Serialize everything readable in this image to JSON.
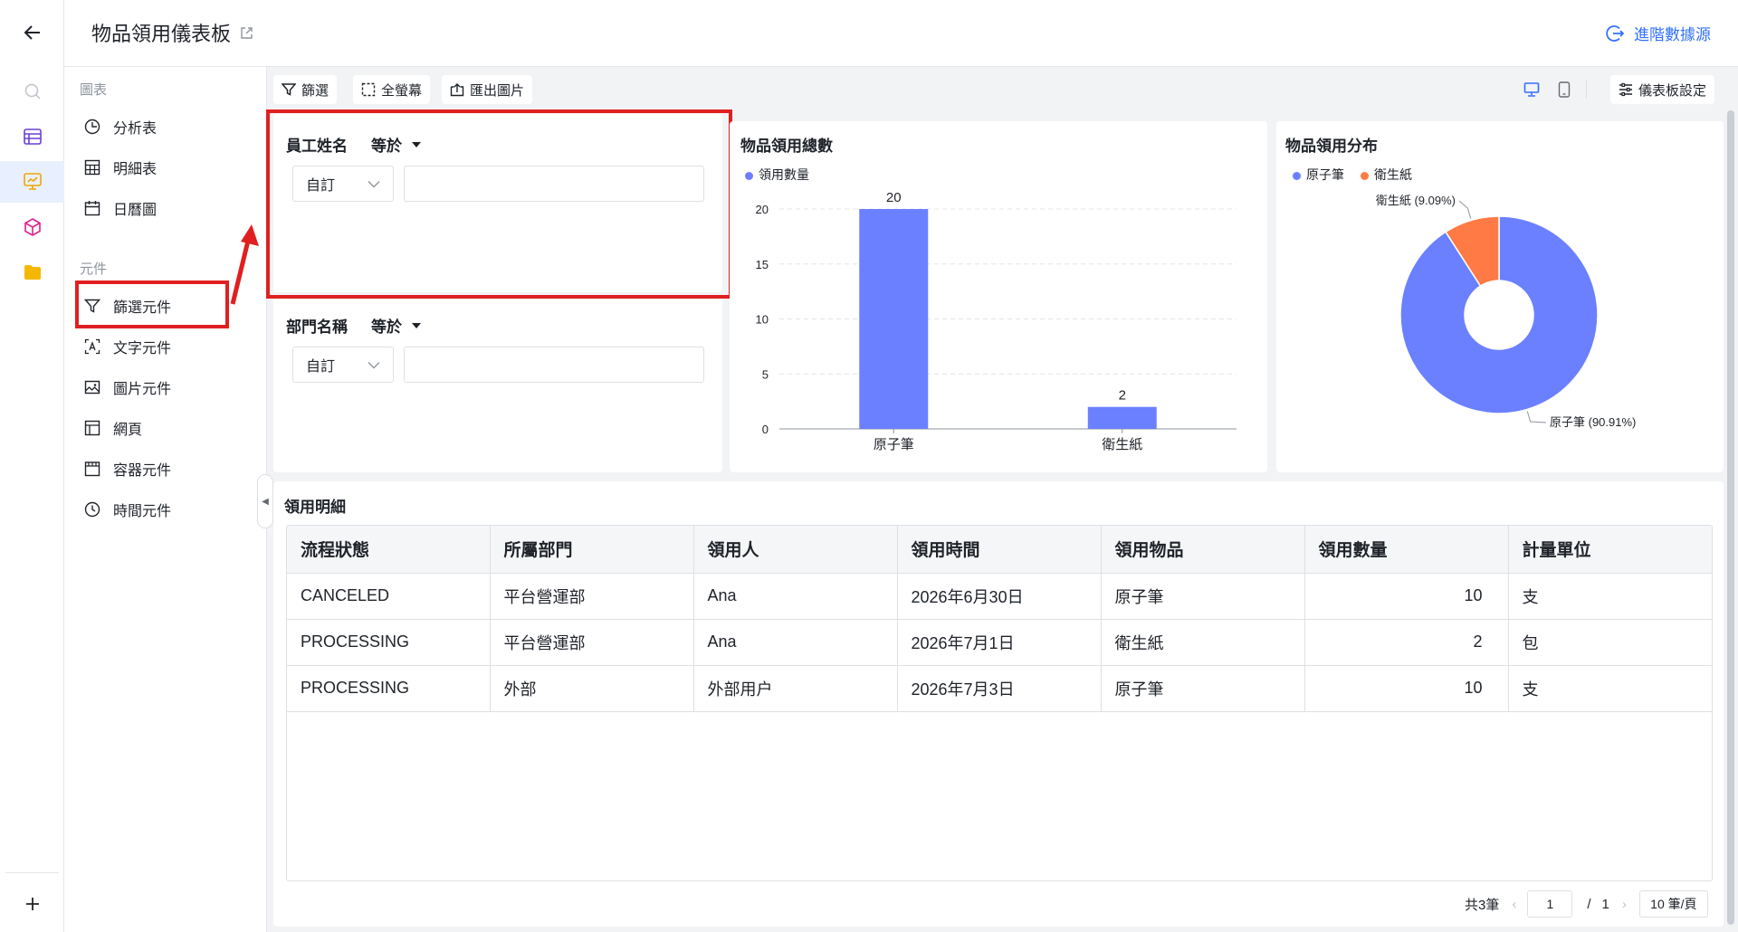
{
  "header": {
    "title": "物品領用儀表板",
    "advanced_source": "進階數據源"
  },
  "panel": {
    "chart_section": "圖表",
    "chart_items": [
      {
        "label": "分析表",
        "icon": "pie-clock-icon"
      },
      {
        "label": "明細表",
        "icon": "table-grid-icon"
      },
      {
        "label": "日曆圖",
        "icon": "calendar-icon"
      }
    ],
    "component_section": "元件",
    "component_items": [
      {
        "label": "篩選元件",
        "icon": "filter-icon"
      },
      {
        "label": "文字元件",
        "icon": "text-icon"
      },
      {
        "label": "圖片元件",
        "icon": "image-icon"
      },
      {
        "label": "網頁",
        "icon": "webpage-icon"
      },
      {
        "label": "容器元件",
        "icon": "container-icon"
      },
      {
        "label": "時間元件",
        "icon": "clock-icon"
      }
    ]
  },
  "toolbar": {
    "filter": "篩選",
    "fullscreen": "全螢幕",
    "export": "匯出圖片",
    "settings": "儀表板設定"
  },
  "filters": [
    {
      "title": "員工姓名",
      "operator": "等於",
      "select_value": "自訂",
      "input_value": ""
    },
    {
      "title": "部門名稱",
      "operator": "等於",
      "select_value": "自訂",
      "input_value": ""
    }
  ],
  "bar_card": {
    "title": "物品領用總數",
    "legend": "領用數量"
  },
  "pie_card": {
    "title": "物品領用分布",
    "legend": [
      "原子筆",
      "衛生紙"
    ],
    "labels": [
      "衛生紙 (9.09%)",
      "原子筆 (90.91%)"
    ]
  },
  "chart_data": [
    {
      "type": "bar",
      "categories": [
        "原子筆",
        "衛生紙"
      ],
      "series": [
        {
          "name": "領用數量",
          "values": [
            20,
            2
          ]
        }
      ],
      "ylim": [
        0,
        20
      ],
      "yticks": [
        0,
        5,
        10,
        15,
        20
      ],
      "grid": true,
      "legend": "top-left",
      "color": "#6b80ff"
    },
    {
      "type": "pie",
      "categories": [
        "原子筆",
        "衛生紙"
      ],
      "values": [
        90.91,
        9.09
      ],
      "colors": [
        "#6b80ff",
        "#ff7a45"
      ],
      "legend": "top-left"
    }
  ],
  "detail": {
    "title": "領用明細",
    "columns": [
      "流程狀態",
      "所屬部門",
      "領用人",
      "領用時間",
      "領用物品",
      "領用數量",
      "計量單位"
    ],
    "rows": [
      [
        "CANCELED",
        "平台營運部",
        "Ana",
        "2026年6月30日",
        "原子筆",
        "10",
        "支"
      ],
      [
        "PROCESSING",
        "平台營運部",
        "Ana",
        "2026年7月1日",
        "衛生紙",
        "2",
        "包"
      ],
      [
        "PROCESSING",
        "外部",
        "外部用户",
        "2026年7月3日",
        "原子筆",
        "10",
        "支"
      ]
    ]
  },
  "pager": {
    "total": "共3筆",
    "current": "1",
    "separator": "/",
    "pages": "1",
    "page_size": "10 筆/頁"
  },
  "colors": {
    "accent": "#3370ff",
    "highlight": "#e02020",
    "bar": "#6b80ff",
    "pie_secondary": "#ff7a45"
  }
}
